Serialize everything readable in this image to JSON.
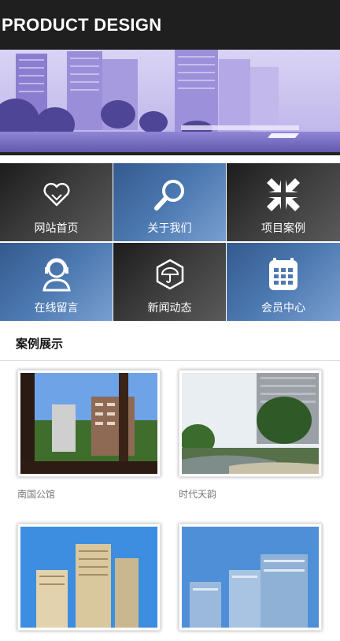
{
  "header": {
    "title": "PRODUCT DESIGN"
  },
  "nav": [
    {
      "label": "网站首页",
      "icon": "heart-icon",
      "style": "dark"
    },
    {
      "label": "关于我们",
      "icon": "search-icon",
      "style": "blue"
    },
    {
      "label": "项目案例",
      "icon": "shrink-arrows-icon",
      "style": "dark"
    },
    {
      "label": "在线留言",
      "icon": "support-agent-icon",
      "style": "blue"
    },
    {
      "label": "新闻动态",
      "icon": "umbrella-hexagon-icon",
      "style": "dark"
    },
    {
      "label": "会员中心",
      "icon": "calculator-icon",
      "style": "blue"
    }
  ],
  "cases": {
    "title": "案例展示",
    "items": [
      {
        "caption": "南国公馆",
        "image": "apartment-window-view-photo"
      },
      {
        "caption": "时代天韵",
        "image": "garden-pond-photo"
      },
      {
        "caption": "",
        "image": "residential-towers-photo"
      },
      {
        "caption": "",
        "image": "glass-towers-photo"
      }
    ]
  },
  "colors": {
    "header_bg": "#1f1f1f",
    "tile_dark": "#2b2b2b",
    "tile_blue": "#4c79b1"
  }
}
